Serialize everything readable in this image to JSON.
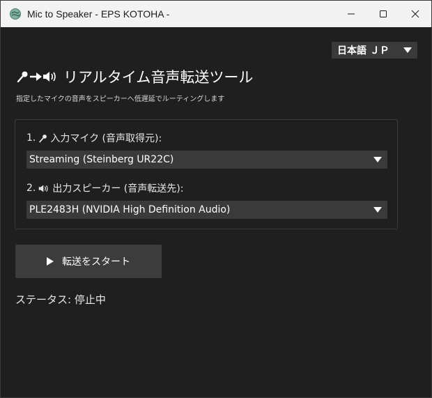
{
  "window": {
    "title": "Mic to Speaker - EPS KOTOHA -"
  },
  "language": {
    "selected": "日本語 ＪＰ"
  },
  "header": {
    "title": "リアルタイム音声転送ツール",
    "subtitle": "指定したマイクの音声をスピーカーへ低遅延でルーティングします"
  },
  "input_section": {
    "prefix": "1.",
    "label": "入力マイク (音声取得元):",
    "selected": "Streaming (Steinberg UR22C)"
  },
  "output_section": {
    "prefix": "2.",
    "label": "出力スピーカー (音声転送先):",
    "selected": "PLE2483H (NVIDIA High Definition Audio)"
  },
  "controls": {
    "start_label": "転送をスタート"
  },
  "status": {
    "text": "ステータス: 停止中"
  },
  "icons": {
    "mic": "microphone-icon",
    "arrow": "arrow-right-icon",
    "speaker": "speaker-icon",
    "play": "play-icon"
  },
  "colors": {
    "background": "#1f1f1f",
    "control": "#3a3a3a",
    "titlebar": "#f3f3f3",
    "text": "#ffffff"
  }
}
